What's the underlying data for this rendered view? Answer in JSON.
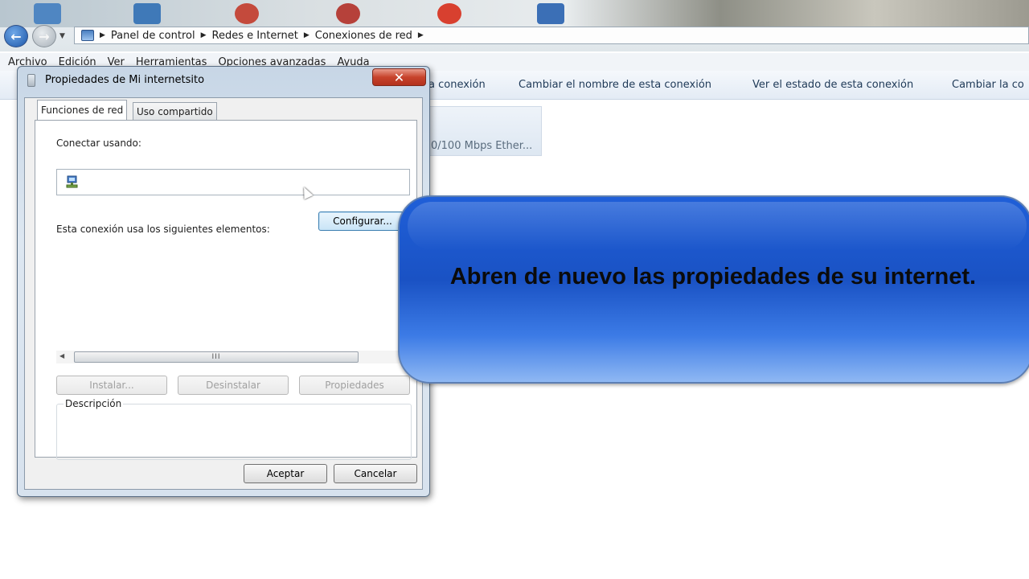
{
  "explorer": {
    "address": {
      "crumbs": [
        "Panel de control",
        "Redes e Internet",
        "Conexiones de red"
      ]
    },
    "menu": [
      "Archivo",
      "Edición",
      "Ver",
      "Herramientas",
      "Opciones avanzadas",
      "Ayuda"
    ],
    "commands": [
      "a conexión",
      "Cambiar el nombre de esta conexión",
      "Ver el estado de esta conexión",
      "Cambiar la co"
    ],
    "adapter_text": "0/100 Mbps Ether..."
  },
  "dialog": {
    "title": "Propiedades de Mi internetsito",
    "close_glyph": "✕",
    "tabs": [
      "Funciones de red",
      "Uso compartido"
    ],
    "connect_label": "Conectar usando:",
    "configure_button": "Configurar...",
    "elements_label": "Esta conexión usa los siguientes elementos:",
    "scroll_grip": "III",
    "install_button": "Instalar...",
    "uninstall_button": "Desinstalar",
    "properties_button": "Propiedades",
    "description_label": "Descripción",
    "accept_button": "Aceptar",
    "cancel_button": "Cancelar"
  },
  "banner": {
    "text": "Abren de nuevo las propiedades de su internet."
  },
  "colors": {
    "banner_blue": "#1a52c4",
    "close_red": "#c7432c",
    "nav_blue": "#1c56a8"
  },
  "icons": [
    "back-arrow-icon",
    "forward-arrow-icon",
    "control-panel-icon",
    "network-adapter-icon",
    "close-icon",
    "cursor-icon"
  ]
}
